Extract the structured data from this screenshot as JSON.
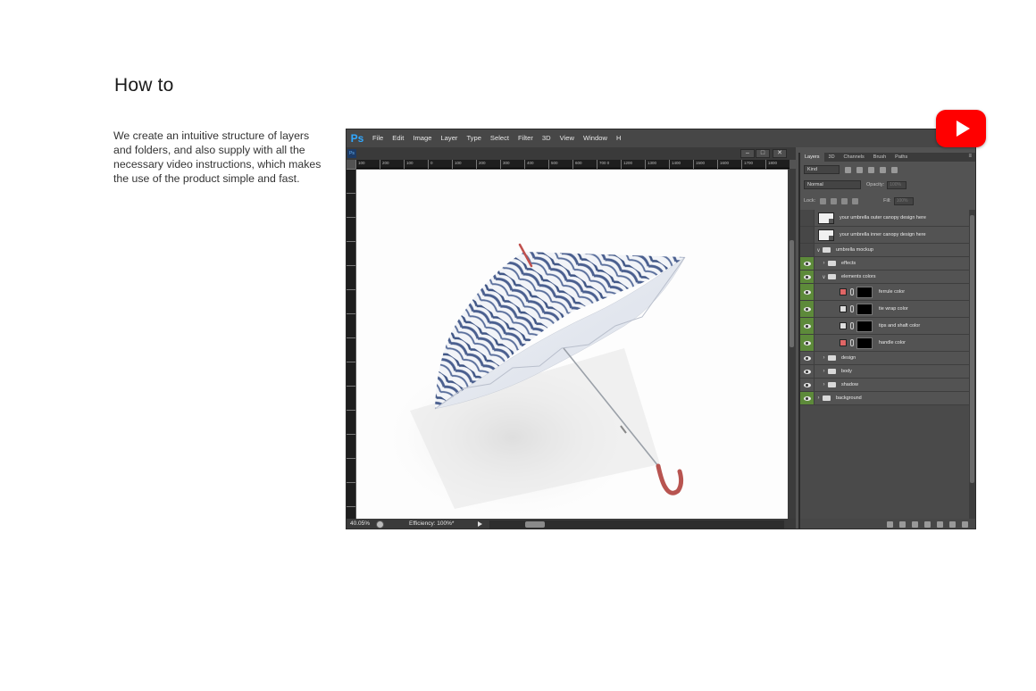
{
  "page": {
    "heading": "How to",
    "description": "We create an intuitive structure of layers and folders, and also supply with all the necessary video instructions, which makes the use of the product simple and fast."
  },
  "photoshop": {
    "logo": "Ps",
    "menu": [
      "File",
      "Edit",
      "Image",
      "Layer",
      "Type",
      "Select",
      "Filter",
      "3D",
      "View",
      "Window",
      "H"
    ],
    "ruler_labels": [
      "100",
      "200",
      "100",
      "0",
      "100",
      "200",
      "300",
      "400",
      "500",
      "600",
      "700 0",
      "1200",
      "1300",
      "1400",
      "1500",
      "1600",
      "1700",
      "1800"
    ],
    "status": {
      "zoom": "40.05%",
      "efficiency": "Efficiency: 100%*"
    },
    "window_buttons": [
      "–",
      "□",
      "✕"
    ]
  },
  "layers_panel": {
    "tabs": [
      "Layers",
      "3D",
      "Channels",
      "Brush",
      "Paths"
    ],
    "active_tab": "Layers",
    "filter_kind": "Kind",
    "blend_mode": "Normal",
    "opacity_label": "Opacity:",
    "opacity_value": "100%",
    "lock_label": "Lock:",
    "fill_label": "Fill:",
    "fill_value": "100%",
    "layers": [
      {
        "name": "your umbrella outer canopy design here",
        "type": "smart",
        "visible": false
      },
      {
        "name": "your umbrella inner canopy design here",
        "type": "smart",
        "visible": false
      },
      {
        "name": "umbrella mockup",
        "type": "group-open",
        "visible": false
      },
      {
        "name": "effects",
        "type": "group",
        "visible": true
      },
      {
        "name": "elements colors",
        "type": "group-open",
        "visible": true
      },
      {
        "name": "ferrule color",
        "type": "fill",
        "swatch": "#e06666",
        "visible": true
      },
      {
        "name": "tie wrap color",
        "type": "fill",
        "swatch": "#dddddd",
        "visible": true
      },
      {
        "name": "tips and shaft color",
        "type": "fill",
        "swatch": "#dddddd",
        "visible": true
      },
      {
        "name": "handle color",
        "type": "fill",
        "swatch": "#e06666",
        "visible": true
      },
      {
        "name": "design",
        "type": "group",
        "visible": false
      },
      {
        "name": "body",
        "type": "group",
        "visible": false
      },
      {
        "name": "shadow",
        "type": "group",
        "visible": false
      },
      {
        "name": "background",
        "type": "group",
        "visible": true
      }
    ]
  },
  "colors": {
    "accent_green": "#5d8a3a",
    "youtube_red": "#ff0000",
    "ps_blue": "#31a8ff"
  },
  "icons": {
    "youtube": "youtube-play-icon"
  }
}
